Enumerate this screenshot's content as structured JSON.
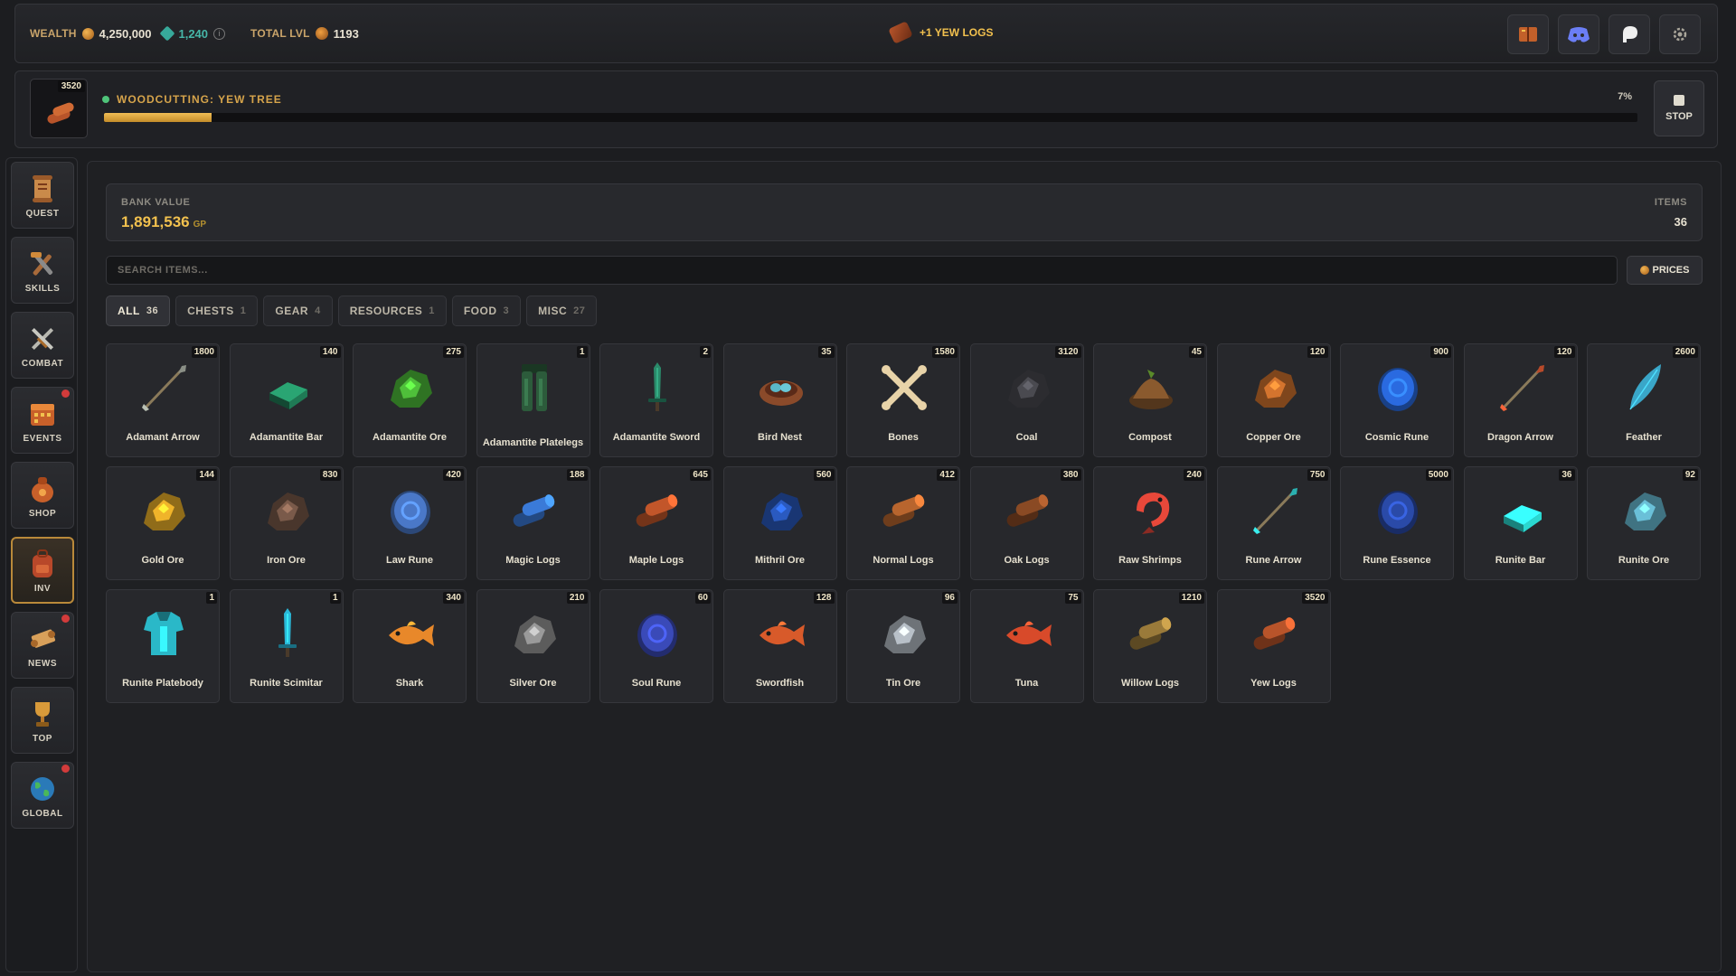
{
  "topbar": {
    "wealth_label": "WEALTH",
    "gold": "4,250,000",
    "gems": "1,240",
    "total_lvl_label": "TOTAL LVL",
    "total_lvl": "1193",
    "toast": "+1 YEW LOGS"
  },
  "activity": {
    "count": "3520",
    "title": "WOODCUTTING: YEW TREE",
    "percent_label": "7%",
    "progress": 0.07,
    "stop_label": "STOP"
  },
  "sidebar": [
    {
      "label": "QUEST",
      "icon": "scroll-icon",
      "badge": false
    },
    {
      "label": "SKILLS",
      "icon": "tools-icon",
      "badge": false
    },
    {
      "label": "COMBAT",
      "icon": "crossed-swords-icon",
      "badge": false
    },
    {
      "label": "EVENTS",
      "icon": "calendar-icon",
      "badge": true
    },
    {
      "label": "SHOP",
      "icon": "bag-icon",
      "badge": false
    },
    {
      "label": "INV",
      "icon": "backpack-icon",
      "badge": false,
      "active": true
    },
    {
      "label": "NEWS",
      "icon": "news-scroll-icon",
      "badge": true
    },
    {
      "label": "TOP",
      "icon": "trophy-icon",
      "badge": false
    },
    {
      "label": "GLOBAL",
      "icon": "globe-icon",
      "badge": true
    }
  ],
  "bank": {
    "value_label": "BANK VALUE",
    "value": "1,891,536",
    "currency": "GP",
    "items_label": "ITEMS",
    "items_count": "36"
  },
  "search": {
    "placeholder": "SEARCH ITEMS..."
  },
  "prices_label": "PRICES",
  "tabs": [
    {
      "label": "ALL",
      "count": "36",
      "active": true
    },
    {
      "label": "CHESTS",
      "count": "1"
    },
    {
      "label": "GEAR",
      "count": "4"
    },
    {
      "label": "RESOURCES",
      "count": "1"
    },
    {
      "label": "FOOD",
      "count": "3"
    },
    {
      "label": "MISC",
      "count": "27"
    }
  ],
  "items": [
    {
      "name": "Adamant Arrow",
      "qty": "1800",
      "icon": "arrow-icon",
      "color": "#8a8f86"
    },
    {
      "name": "Adamantite Bar",
      "qty": "140",
      "icon": "bar-icon",
      "color": "#1f7a55"
    },
    {
      "name": "Adamantite Ore",
      "qty": "275",
      "icon": "ore-icon",
      "color": "#4fbf3a"
    },
    {
      "name": "Adamantite Platelegs",
      "qty": "1",
      "icon": "platelegs-icon",
      "color": "#2c5b3b"
    },
    {
      "name": "Adamantite Sword",
      "qty": "2",
      "icon": "sword-icon",
      "color": "#2a8a6a"
    },
    {
      "name": "Bird Nest",
      "qty": "35",
      "icon": "nest-icon",
      "color": "#9a5a3a"
    },
    {
      "name": "Bones",
      "qty": "1580",
      "icon": "bones-icon",
      "color": "#e8d3a8"
    },
    {
      "name": "Coal",
      "qty": "3120",
      "icon": "ore-icon",
      "color": "#4a4a50"
    },
    {
      "name": "Compost",
      "qty": "45",
      "icon": "compost-icon",
      "color": "#8a5a2e"
    },
    {
      "name": "Copper Ore",
      "qty": "120",
      "icon": "ore-icon",
      "color": "#d4742e"
    },
    {
      "name": "Cosmic Rune",
      "qty": "900",
      "icon": "rune-icon",
      "color": "#2a6ae0"
    },
    {
      "name": "Dragon Arrow",
      "qty": "120",
      "icon": "arrow-icon",
      "color": "#b84a2a"
    },
    {
      "name": "Feather",
      "qty": "2600",
      "icon": "feather-icon",
      "color": "#3aa6c8"
    },
    {
      "name": "Gold Ore",
      "qty": "144",
      "icon": "ore-icon",
      "color": "#f0b42a"
    },
    {
      "name": "Iron Ore",
      "qty": "830",
      "icon": "ore-icon",
      "color": "#7a5a4a"
    },
    {
      "name": "Law Rune",
      "qty": "420",
      "icon": "rune-icon",
      "color": "#4a78c8"
    },
    {
      "name": "Magic Logs",
      "qty": "188",
      "icon": "logs-icon",
      "color": "#3a7ad8"
    },
    {
      "name": "Maple Logs",
      "qty": "645",
      "icon": "logs-icon",
      "color": "#c2562a"
    },
    {
      "name": "Mithril Ore",
      "qty": "560",
      "icon": "ore-icon",
      "color": "#2a5ac0"
    },
    {
      "name": "Normal Logs",
      "qty": "412",
      "icon": "logs-icon",
      "color": "#b8652e"
    },
    {
      "name": "Oak Logs",
      "qty": "380",
      "icon": "logs-icon",
      "color": "#8a4a24"
    },
    {
      "name": "Raw Shrimps",
      "qty": "240",
      "icon": "shrimp-icon",
      "color": "#e8483a"
    },
    {
      "name": "Rune Arrow",
      "qty": "750",
      "icon": "arrow-icon",
      "color": "#2ab0b0"
    },
    {
      "name": "Rune Essence",
      "qty": "5000",
      "icon": "rune-icon",
      "color": "#2a4aa8"
    },
    {
      "name": "Runite Bar",
      "qty": "36",
      "icon": "bar-icon",
      "color": "#2ad8d0"
    },
    {
      "name": "Runite Ore",
      "qty": "92",
      "icon": "ore-icon",
      "color": "#6ac0d8"
    },
    {
      "name": "Runite Platebody",
      "qty": "1",
      "icon": "platebody-icon",
      "color": "#2ab8c8"
    },
    {
      "name": "Runite Scimitar",
      "qty": "1",
      "icon": "sword-icon",
      "color": "#2ab8d8"
    },
    {
      "name": "Shark",
      "qty": "340",
      "icon": "fish-icon",
      "color": "#e8882a"
    },
    {
      "name": "Silver Ore",
      "qty": "210",
      "icon": "ore-icon",
      "color": "#9a9a9a"
    },
    {
      "name": "Soul Rune",
      "qty": "60",
      "icon": "rune-icon",
      "color": "#3a4ab8"
    },
    {
      "name": "Swordfish",
      "qty": "128",
      "icon": "fish-icon",
      "color": "#d85a2a"
    },
    {
      "name": "Tin Ore",
      "qty": "96",
      "icon": "ore-icon",
      "color": "#b8c0c8"
    },
    {
      "name": "Tuna",
      "qty": "75",
      "icon": "fish-icon",
      "color": "#d84a2a"
    },
    {
      "name": "Willow Logs",
      "qty": "1210",
      "icon": "logs-icon",
      "color": "#9a7a3a"
    },
    {
      "name": "Yew Logs",
      "qty": "3520",
      "icon": "logs-icon",
      "color": "#b8542a"
    }
  ]
}
